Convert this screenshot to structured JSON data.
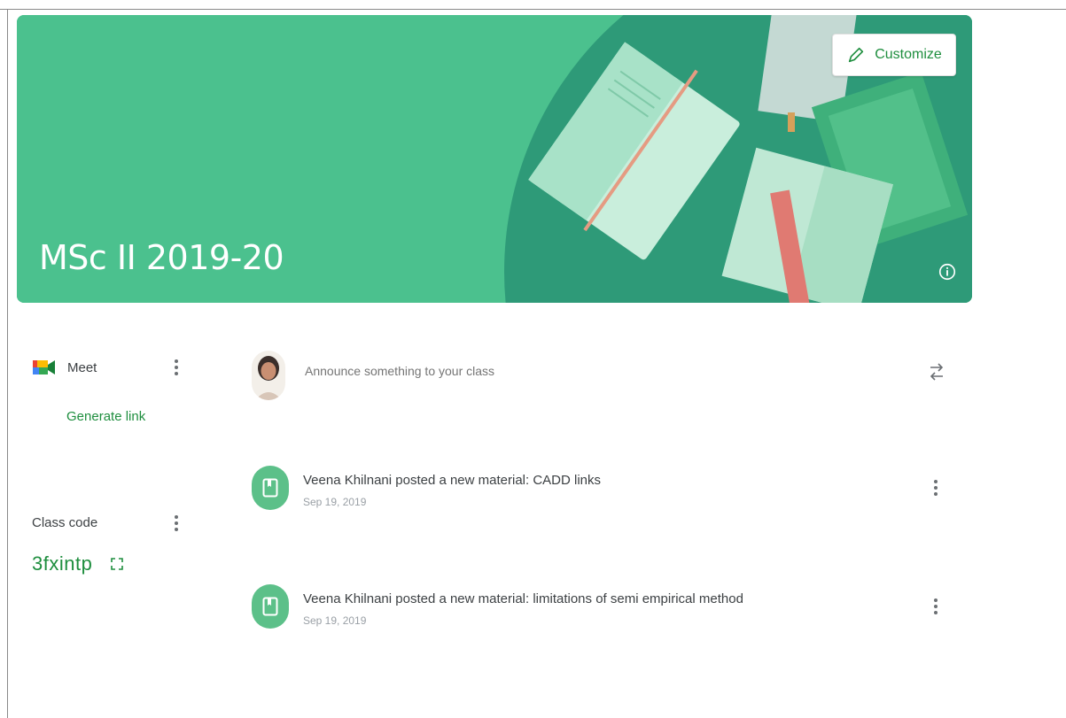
{
  "colors": {
    "banner_primary": "#4bc18e",
    "banner_dark": "#2e9a78",
    "accent_green": "#1e8e3e",
    "material_circle": "#5cc089",
    "text_primary": "#3c4043",
    "text_muted": "#9aa0a6"
  },
  "banner": {
    "title": "MSc II 2019-20",
    "customize_label": "Customize",
    "customize_icon": "pencil-icon",
    "info_icon": "info-icon",
    "illustration": "books-illustration"
  },
  "meet": {
    "icon": "meet-logo-icon",
    "label": "Meet",
    "menu_icon": "more-vert-icon",
    "generate_link_label": "Generate link"
  },
  "class_code": {
    "label": "Class code",
    "menu_icon": "more-vert-icon",
    "value": "3fxintp",
    "expand_icon": "fullscreen-icon"
  },
  "announce": {
    "avatar": "teacher-avatar",
    "placeholder": "Announce something to your class",
    "repost_icon": "repost-icon"
  },
  "stream": {
    "posts": [
      {
        "icon": "material-book-icon",
        "title": "Veena Khilnani posted a new material: CADD links",
        "date": "Sep 19, 2019",
        "menu_icon": "more-vert-icon"
      },
      {
        "icon": "material-book-icon",
        "title": "Veena Khilnani posted a new material: limitations of semi empirical method",
        "date": "Sep 19, 2019",
        "menu_icon": "more-vert-icon"
      }
    ]
  }
}
